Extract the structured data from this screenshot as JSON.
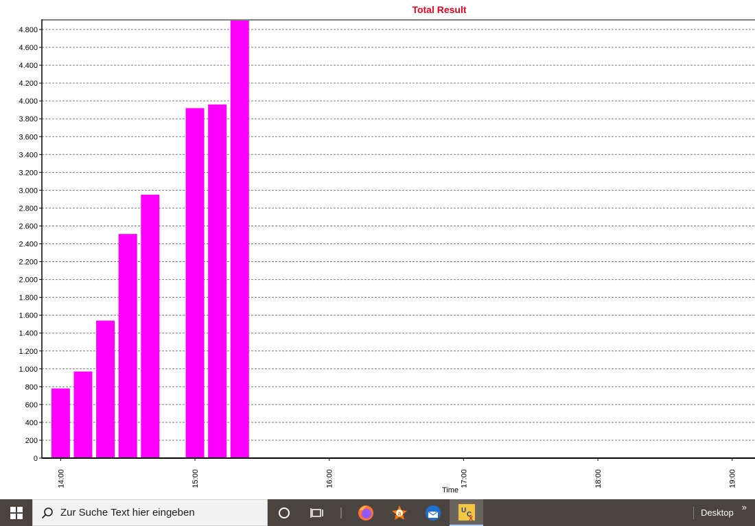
{
  "chart_data": {
    "type": "bar",
    "title": "Total Result",
    "title_color": "#e8001c",
    "bar_color": "#ff00ff",
    "xlabel": "Time",
    "ylabel": "",
    "ylim": [
      0,
      4900
    ],
    "y_ticks": [
      "0",
      "200",
      "400",
      "600",
      "800",
      "1.000",
      "1.200",
      "1.400",
      "1.600",
      "1.800",
      "2.000",
      "2.200",
      "2.400",
      "2.600",
      "2.800",
      "3.000",
      "3.200",
      "3.400",
      "3.600",
      "3.800",
      "4.000",
      "4.200",
      "4.400",
      "4.600",
      "4.800"
    ],
    "y_tick_values": [
      0,
      200,
      400,
      600,
      800,
      1000,
      1200,
      1400,
      1600,
      1800,
      2000,
      2200,
      2400,
      2600,
      2800,
      3000,
      3200,
      3400,
      3600,
      3800,
      4000,
      4200,
      4400,
      4600,
      4800
    ],
    "x_ticks": [
      "14:00",
      "15:00",
      "16:00",
      "17:00",
      "18:00",
      "19:00"
    ],
    "x_tick_hours": [
      14,
      15,
      16,
      17,
      18,
      19
    ],
    "xlim_hours": [
      13.86,
      19.17
    ],
    "grid": "horizontal-dashed",
    "bars": [
      {
        "x": "14:00",
        "value": 780
      },
      {
        "x": "14:10",
        "value": 970
      },
      {
        "x": "14:20",
        "value": 1540
      },
      {
        "x": "14:30",
        "value": 2510
      },
      {
        "x": "14:40",
        "value": 2950
      },
      {
        "x": "15:00",
        "value": 3920
      },
      {
        "x": "15:10",
        "value": 3960
      },
      {
        "x": "15:20",
        "value": 4900
      }
    ]
  },
  "taskbar": {
    "search_placeholder": "Zur Suche Text hier eingeben",
    "desktop_label": "Desktop",
    "chevrons": "»",
    "start_icon": "windows-logo-icon",
    "apps": [
      "firefox-icon",
      "avast-icon",
      "thunderbird-icon",
      "ucx-app-icon"
    ]
  }
}
